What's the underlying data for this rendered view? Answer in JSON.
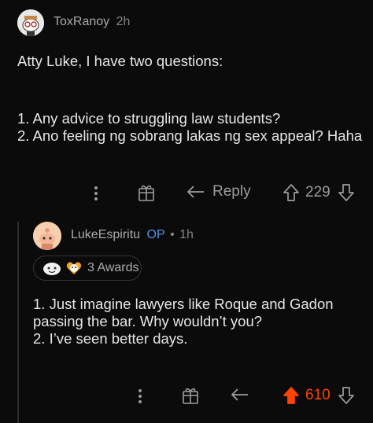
{
  "comment": {
    "author": "ToxRanoy",
    "time": "2h",
    "lines": [
      "Atty Luke, I have two questions:",
      "1. Any advice to struggling law students?",
      "2. Ano feeling ng sobrang lakas ng sex appeal? Haha"
    ],
    "actions": {
      "reply_label": "Reply",
      "score": "229"
    }
  },
  "reply": {
    "author": "LukeEspiritu",
    "op_badge": "OP",
    "separator": "•",
    "time": "1h",
    "awards_label": "3 Awards",
    "lines": [
      "1. Just imagine lawyers like Roque and Gadon",
      "passing the bar. Why wouldn’t you?",
      "2. I’ve seen better days."
    ],
    "actions": {
      "score": "610",
      "score_color": "#ff4500"
    }
  },
  "icons": [
    "more-icon",
    "award-icon",
    "reply-arrow-icon",
    "upvote-icon",
    "downvote-icon",
    "snoo-avatar-icon"
  ]
}
